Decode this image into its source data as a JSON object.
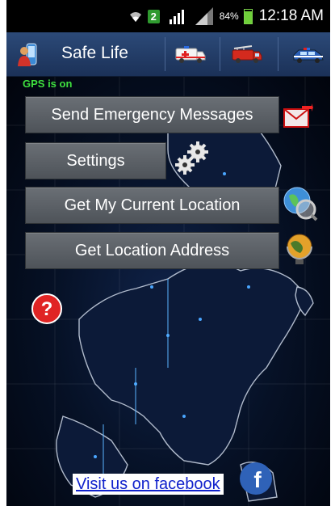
{
  "status_bar": {
    "network_badge": "2",
    "battery_percent": "84%",
    "battery_level": 0.84,
    "time": "12:18 AM"
  },
  "action_bar": {
    "app_title": "Safe Life",
    "icons": [
      "app-logo-icon",
      "ambulance-icon",
      "fire-truck-icon",
      "police-car-icon"
    ]
  },
  "main": {
    "gps_status": "GPS is on",
    "buttons": {
      "send": "Send Emergency Messages",
      "settings": "Settings",
      "location": "Get My Current Location",
      "address": "Get Location Address"
    },
    "facebook_link": "Visit us on facebook"
  },
  "colors": {
    "action_bar": "#1f3a66",
    "button": "#5b6066",
    "gps_text": "#3fe03f",
    "link": "#1122cc",
    "background": "#061126"
  }
}
